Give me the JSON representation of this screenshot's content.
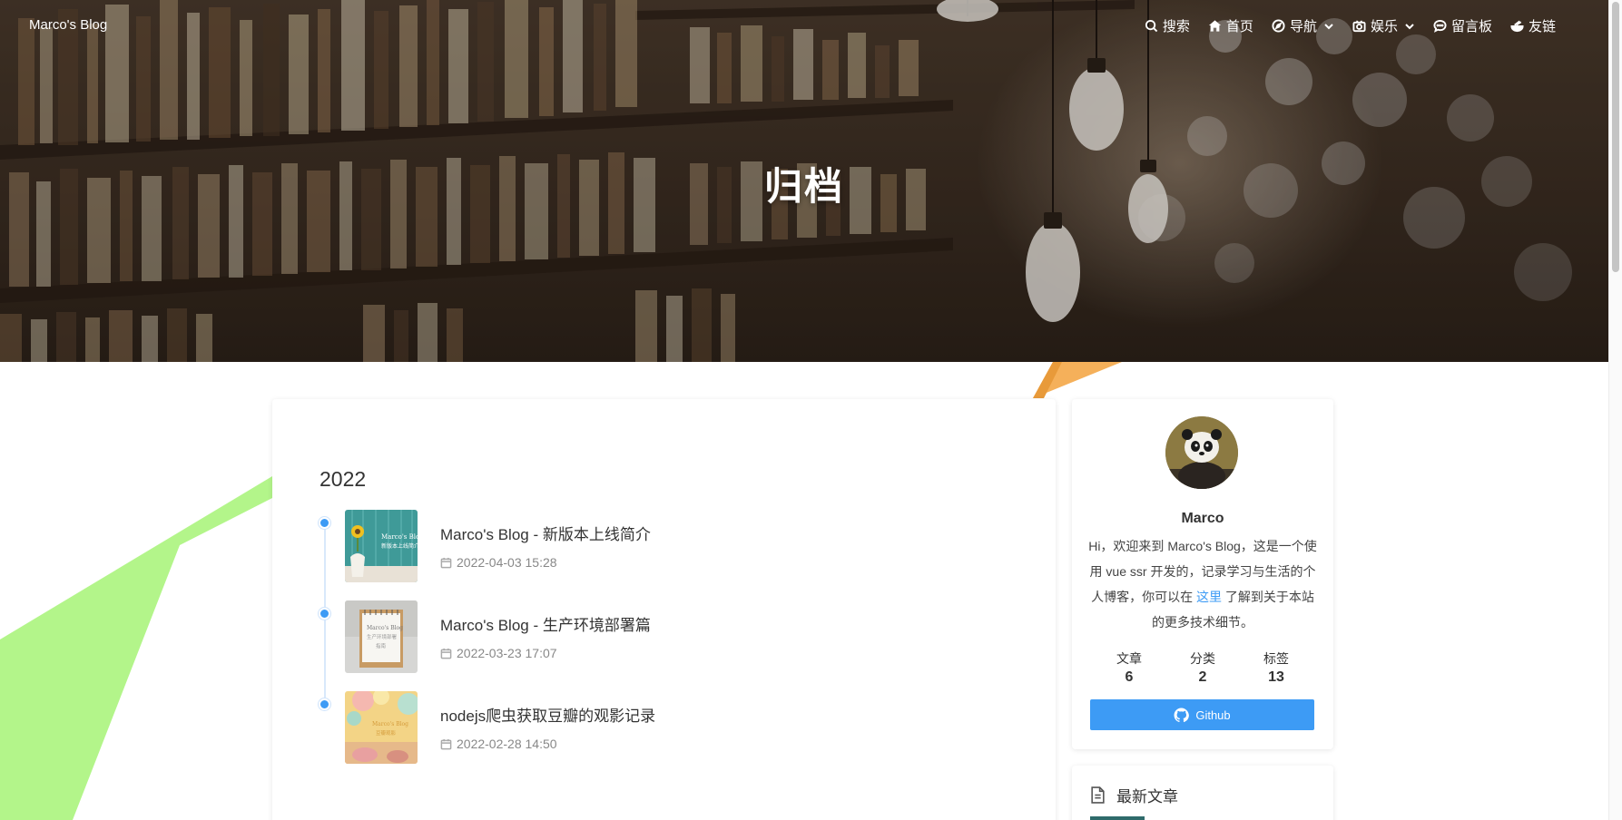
{
  "nav": {
    "brand": "Marco's Blog",
    "items": [
      {
        "label": "搜索",
        "icon": "search-icon"
      },
      {
        "label": "首页",
        "icon": "home-icon"
      },
      {
        "label": "导航",
        "icon": "compass-icon",
        "dropdown": true
      },
      {
        "label": "娱乐",
        "icon": "camera-icon",
        "dropdown": true
      },
      {
        "label": "留言板",
        "icon": "message-icon"
      },
      {
        "label": "友链",
        "icon": "bowl-icon"
      }
    ]
  },
  "hero": {
    "title": "归档"
  },
  "archive": {
    "year": "2022",
    "posts": [
      {
        "title": "Marco's Blog - 新版本上线简介",
        "date": "2022-04-03 15:28"
      },
      {
        "title": "Marco's Blog - 生产环境部署篇",
        "date": "2022-03-23 17:07"
      },
      {
        "title": "nodejs爬虫获取豆瓣的观影记录",
        "date": "2022-02-28 14:50"
      }
    ]
  },
  "profile": {
    "name": "Marco",
    "bio_before": "Hi，欢迎来到 Marco's Blog，这是一个使用 vue ssr 开发的，记录学习与生活的个人博客，你可以在 ",
    "bio_link": "这里",
    "bio_after": " 了解到关于本站的更多技术细节。",
    "stats": [
      {
        "label": "文章",
        "value": "6"
      },
      {
        "label": "分类",
        "value": "2"
      },
      {
        "label": "标签",
        "value": "13"
      }
    ],
    "github_label": "Github"
  },
  "recent": {
    "title": "最新文章"
  },
  "colors": {
    "accent": "#3d9bf5",
    "decor_green": "#b3f58a",
    "decor_orange": "#f5b05a"
  }
}
